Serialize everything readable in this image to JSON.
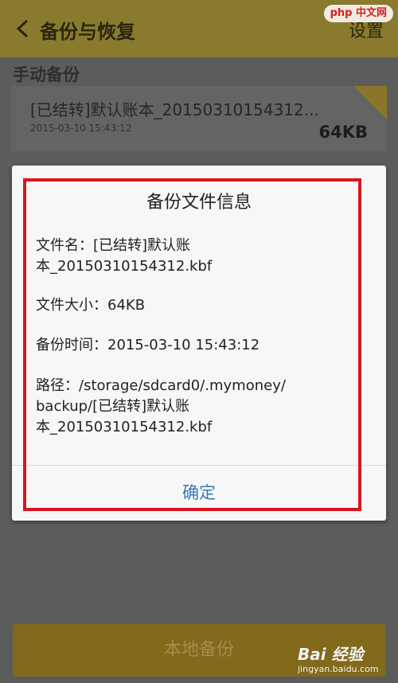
{
  "header": {
    "title": "备份与恢复",
    "settings_label": "设置"
  },
  "manual_backup": {
    "section_title": "手动备份",
    "item": {
      "name": "[已结转]默认账本_20150310154312...",
      "time": "2015-03-10 15:43:12",
      "size": "64KB"
    }
  },
  "dialog": {
    "title": "备份文件信息",
    "filename_line1": "文件名：[已结转]默认账",
    "filename_line2": "本_20150310154312.kbf",
    "filesize": "文件大小：64KB",
    "backup_time": "备份时间：2015-03-10 15:43:12",
    "path_line1": "路径：/storage/sdcard0/.mymoney/",
    "path_line2": "backup/[已结转]默认账",
    "path_line3": "本_20150310154312.kbf",
    "ok_label": "确定"
  },
  "bottom_button": {
    "label": "本地备份"
  },
  "watermarks": {
    "top": "php 中文网",
    "bottom_brand": "Bai 经验",
    "bottom_url": "jingyan.baidu.com"
  },
  "colors": {
    "header_bg": "#8a7a2e",
    "dialog_bg": "#f7f7f7",
    "ok_text": "#3b78b4",
    "highlight_border": "#d8161f"
  }
}
